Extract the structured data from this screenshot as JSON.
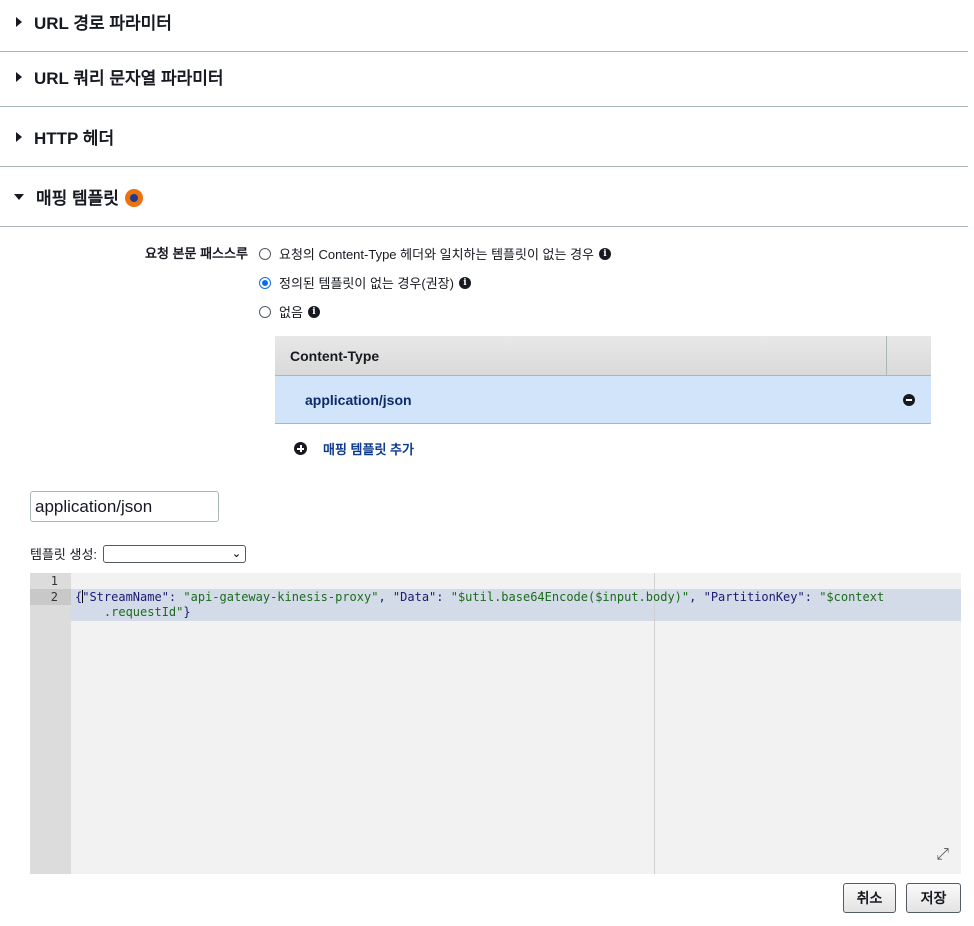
{
  "sections": [
    {
      "title": "URL 경로 파라미터",
      "expanded": false
    },
    {
      "title": "URL 쿼리 문자열 파라미터",
      "expanded": false
    },
    {
      "title": "HTTP 헤더",
      "expanded": false
    },
    {
      "title": "매핑 템플릿",
      "expanded": true
    }
  ],
  "passthrough": {
    "label": "요청 본문 패스스루",
    "options": [
      {
        "label": "요청의 Content-Type 헤더와 일치하는 템플릿이 없는 경우",
        "selected": false
      },
      {
        "label": "정의된 템플릿이 없는 경우(권장)",
        "selected": true
      },
      {
        "label": "없음",
        "selected": false
      }
    ]
  },
  "content_type_table": {
    "header": "Content-Type",
    "rows": [
      "application/json"
    ]
  },
  "add_template_label": "매핑 템플릿 추가",
  "content_type_input_value": "application/json",
  "generate_template": {
    "label": "템플릿 생성:",
    "selected": ""
  },
  "editor": {
    "line_numbers": [
      "1",
      "2"
    ],
    "line2_part1_a": "{",
    "line2_part1_b": "\"StreamName\": ",
    "line2_s1": "\"api-gateway-kinesis-proxy\"",
    "line2_k2": ", \"Data\": ",
    "line2_s2": "\"$util.base64Encode($input.body)\"",
    "line2_k3": ", \"PartitionKey\": ",
    "line2_s3": "\"$context",
    "line3_s": "    .requestId\"",
    "line3_end": "}"
  },
  "buttons": {
    "cancel": "취소",
    "save": "저장"
  },
  "colors": {
    "changed_indicator": "#ec7211",
    "selected_row": "#d1e4fa",
    "radio_checked": "#0a6cf5"
  }
}
